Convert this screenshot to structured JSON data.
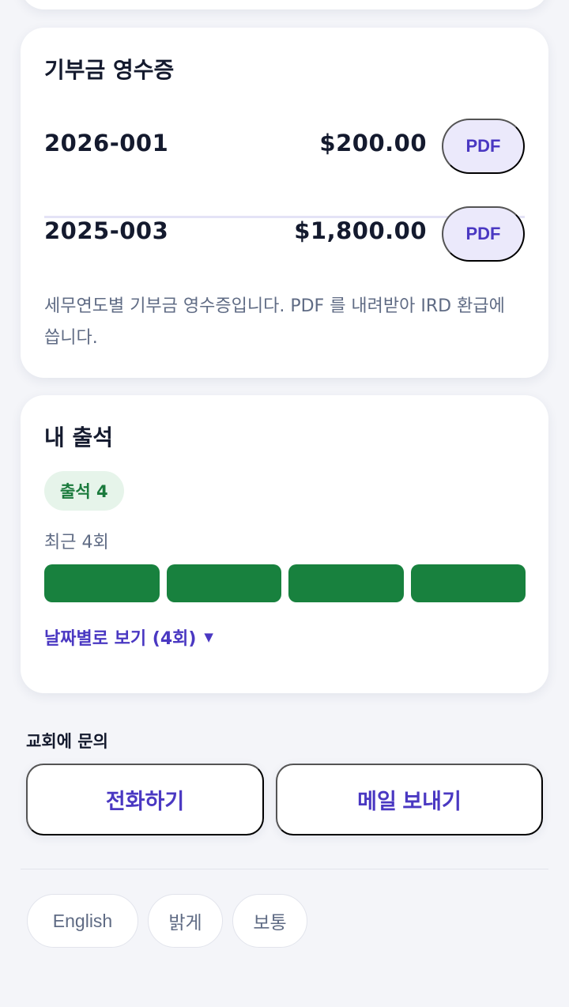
{
  "receipts": {
    "title": "기부금 영수증",
    "items": [
      {
        "id": "2026-001",
        "amount": "$200.00",
        "button_label": "PDF"
      },
      {
        "id": "2025-003",
        "amount": "$1,800.00",
        "button_label": "PDF"
      }
    ],
    "note": "세무연도별 기부금 영수증입니다. PDF 를 내려받아 IRD 환급에 씁니다."
  },
  "attendance": {
    "title": "내 출석",
    "badge": "출석 4",
    "recent_label": "최근 4회",
    "recent": [
      {
        "status": "present"
      },
      {
        "status": "present"
      },
      {
        "status": "present"
      },
      {
        "status": "present"
      }
    ],
    "present_color": "#18813e",
    "expand_label": "날짜별로 보기 (4회)",
    "expand_icon": "▼"
  },
  "contact": {
    "heading": "교회에 문의",
    "call_label": "전화하기",
    "email_label": "메일 보내기"
  },
  "footer": {
    "language_label": "English",
    "theme_label": "밝게",
    "text_size_label": "보통"
  },
  "colors": {
    "accent": "#4a38c2",
    "accent_soft": "#ebe9fb",
    "success": "#18813e",
    "background": "#f4f5f9"
  }
}
